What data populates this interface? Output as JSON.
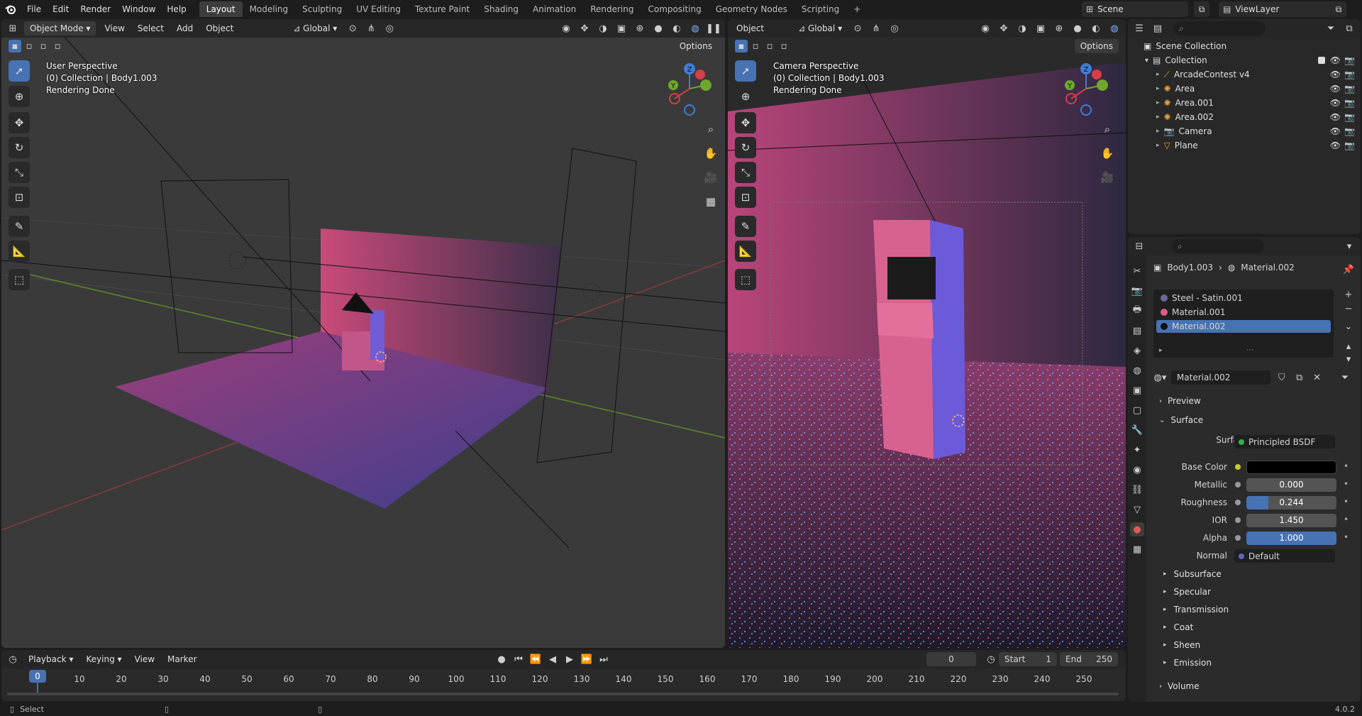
{
  "menu": [
    "File",
    "Edit",
    "Render",
    "Window",
    "Help"
  ],
  "workspaces": [
    "Layout",
    "Modeling",
    "Sculpting",
    "UV Editing",
    "Texture Paint",
    "Shading",
    "Animation",
    "Rendering",
    "Compositing",
    "Geometry Nodes",
    "Scripting"
  ],
  "active_workspace": "Layout",
  "add_workspace": "+",
  "scene": "Scene",
  "view_layer": "ViewLayer",
  "left_viewport": {
    "mode": "Object Mode",
    "menus": [
      "View",
      "Select",
      "Add",
      "Object"
    ],
    "orientation": "Global",
    "options": "Options",
    "info": [
      "User Perspective",
      "(0) Collection | Body1.003",
      "Rendering Done"
    ]
  },
  "right_viewport": {
    "mode": "Object",
    "orientation": "Global",
    "options": "Options",
    "info": [
      "Camera Perspective",
      "(0) Collection | Body1.003",
      "Rendering Done"
    ]
  },
  "gizmo": {
    "x": "X",
    "y": "Y",
    "z": "Z"
  },
  "outliner": {
    "root": "Scene Collection",
    "collection": "Collection",
    "items": [
      {
        "name": "ArcadeContest v4",
        "icon": "armature-icon",
        "color": "#e8a33b"
      },
      {
        "name": "Area",
        "icon": "light-icon",
        "color": "#e8a33b"
      },
      {
        "name": "Area.001",
        "icon": "light-icon",
        "color": "#e8a33b"
      },
      {
        "name": "Area.002",
        "icon": "light-icon",
        "color": "#e8a33b"
      },
      {
        "name": "Camera",
        "icon": "camera-icon",
        "color": "#e8a33b"
      },
      {
        "name": "Plane",
        "icon": "mesh-icon",
        "color": "#e8a33b"
      }
    ]
  },
  "properties": {
    "breadcrumb_object": "Body1.003",
    "breadcrumb_material": "Material.002",
    "slots": [
      {
        "name": "Steel - Satin.001",
        "color": "#6a6a9a"
      },
      {
        "name": "Material.001",
        "color": "#e05a8a"
      },
      {
        "name": "Material.002",
        "color": "#111111"
      }
    ],
    "material_name": "Material.002",
    "panels": {
      "preview": "Preview",
      "surface": "Surface"
    },
    "surface_label": "Surface",
    "surface_value": "Principled BSDF",
    "fields": [
      {
        "label": "Base Color",
        "value": "",
        "type": "color",
        "color": "#000000"
      },
      {
        "label": "Metallic",
        "value": "0.000",
        "type": "slider",
        "fill": 0.0
      },
      {
        "label": "Roughness",
        "value": "0.244",
        "type": "slider",
        "fill": 0.244
      },
      {
        "label": "IOR",
        "value": "1.450",
        "type": "slider",
        "fill": 0.0
      },
      {
        "label": "Alpha",
        "value": "1.000",
        "type": "slider",
        "fill": 1.0
      }
    ],
    "normal_label": "Normal",
    "normal_value": "Default",
    "subpanels": [
      "Subsurface",
      "Specular",
      "Transmission",
      "Coat",
      "Sheen",
      "Emission"
    ],
    "volume": "Volume"
  },
  "timeline": {
    "menus": [
      "Playback",
      "Keying",
      "View",
      "Marker"
    ],
    "current_frame": "0",
    "start_label": "Start",
    "start": "1",
    "end_label": "End",
    "end": "250",
    "ticks": [
      "0",
      "10",
      "20",
      "30",
      "40",
      "50",
      "60",
      "70",
      "80",
      "90",
      "100",
      "110",
      "120",
      "130",
      "140",
      "150",
      "160",
      "170",
      "180",
      "190",
      "200",
      "210",
      "220",
      "230",
      "240",
      "250"
    ]
  },
  "status": {
    "left": "Select",
    "version": "4.0.2"
  }
}
